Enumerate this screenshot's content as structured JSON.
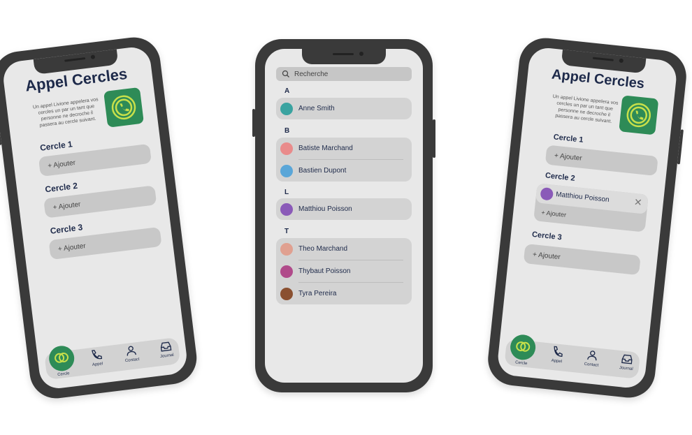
{
  "left_phone": {
    "title": "Appel Cercles",
    "description": "Un appel Livione appelera vos cercles un par un tant que personne ne decroche il passera au cercle suivant.",
    "circles": [
      {
        "label": "Cercle 1",
        "add": "+ Ajouter"
      },
      {
        "label": "Cercle 2",
        "add": "+ Ajouter"
      },
      {
        "label": "Cercle 3",
        "add": "+ Ajouter"
      }
    ],
    "nav": [
      "Cercle",
      "Appel",
      "Contact",
      "Journal"
    ]
  },
  "middle_phone": {
    "search_placeholder": "Recherche",
    "sections": [
      {
        "letter": "A",
        "contacts": [
          "Anne Smith"
        ]
      },
      {
        "letter": "B",
        "contacts": [
          "Batiste Marchand",
          "Bastien Dupont"
        ]
      },
      {
        "letter": "L",
        "contacts": [
          "Matthiou Poisson"
        ]
      },
      {
        "letter": "T",
        "contacts": [
          "Theo Marchand",
          "Thybaut Poisson",
          "Tyra Pereira"
        ]
      }
    ]
  },
  "right_phone": {
    "title": "Appel Cercles",
    "description": "Un appel Livione appelera vos cercles un par un tant que personne ne decroche il passera au cercle suivant.",
    "circle1": {
      "label": "Cercle 1",
      "add": "+ Ajouter"
    },
    "circle2": {
      "label": "Cercle 2",
      "member": "Matthiou Poisson",
      "add": "+ Ajouter"
    },
    "circle3": {
      "label": "Cercle 3",
      "add": "+ Ajouter"
    },
    "nav": [
      "Cercle",
      "Appel",
      "Contact",
      "Journal"
    ]
  },
  "colors": {
    "brand_green": "#2e8b57",
    "logo_lines": "#c8e04a",
    "navy": "#1e2a4a"
  }
}
